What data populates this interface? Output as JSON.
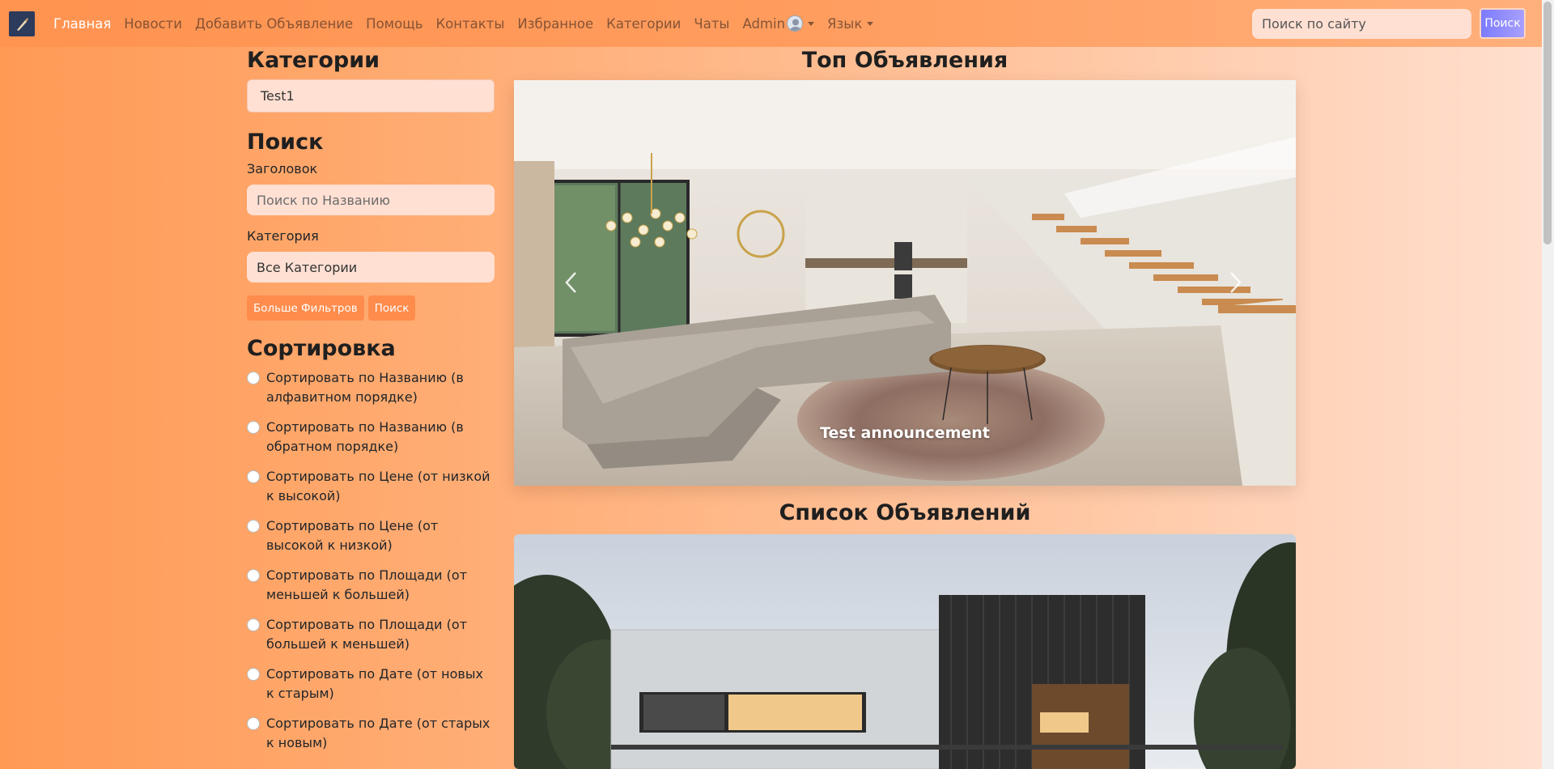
{
  "navbar": {
    "links": [
      {
        "label": "Главная",
        "active": true
      },
      {
        "label": "Новости"
      },
      {
        "label": "Добавить Объявление"
      },
      {
        "label": "Помощь"
      },
      {
        "label": "Контакты"
      },
      {
        "label": "Избранное"
      },
      {
        "label": "Категории"
      },
      {
        "label": "Чаты"
      }
    ],
    "user": "Admin",
    "language": "Язык",
    "search_placeholder": "Поиск по сайту",
    "search_button": "Поиск"
  },
  "sidebar": {
    "categories_title": "Категории",
    "category_item": "Test1",
    "search_title": "Поиск",
    "title_label": "Заголовок",
    "title_placeholder": "Поиск по Названию",
    "category_label": "Категория",
    "category_select": "Все Категории",
    "more_filters_button": "Больше Фильтров",
    "search_button": "Поиск",
    "sort_title": "Сортировка",
    "sort_options": [
      "Сортировать по Названию (в алфавитном порядке)",
      "Сортировать по Названию (в обратном порядке)",
      "Сортировать по Цене (от низкой к высокой)",
      "Сортировать по Цене (от высокой к низкой)",
      "Сортировать по Площади (от меньшей к большей)",
      "Сортировать по Площади (от большей к меньшей)",
      "Сортировать по Дате (от новых к старым)",
      "Сортировать по Дате (от старых к новым)"
    ]
  },
  "main": {
    "top_title": "Топ Объявления",
    "carousel_caption": "Test announcement",
    "list_title": "Список Объявлений"
  },
  "colors": {
    "accent": "#ff8c4c",
    "nav_active": "#ffffff"
  }
}
